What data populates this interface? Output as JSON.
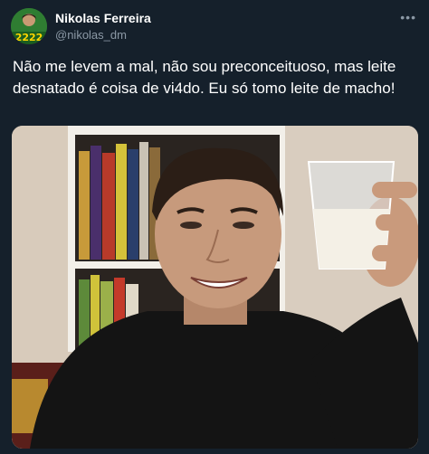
{
  "tweet": {
    "author_name": "Nikolas Ferreira",
    "author_handle": "@nikolas_dm",
    "avatar_badge": "2222",
    "more_icon": "more-icon",
    "text": "Não me levem a mal, não sou preconceituoso, mas leite desnatado é coisa de vi4do. Eu só tomo leite de macho!"
  },
  "media": {
    "description_icon": "photo"
  },
  "colors": {
    "background": "#15202b",
    "text": "#ffffff",
    "secondary_text": "#8b98a5"
  }
}
